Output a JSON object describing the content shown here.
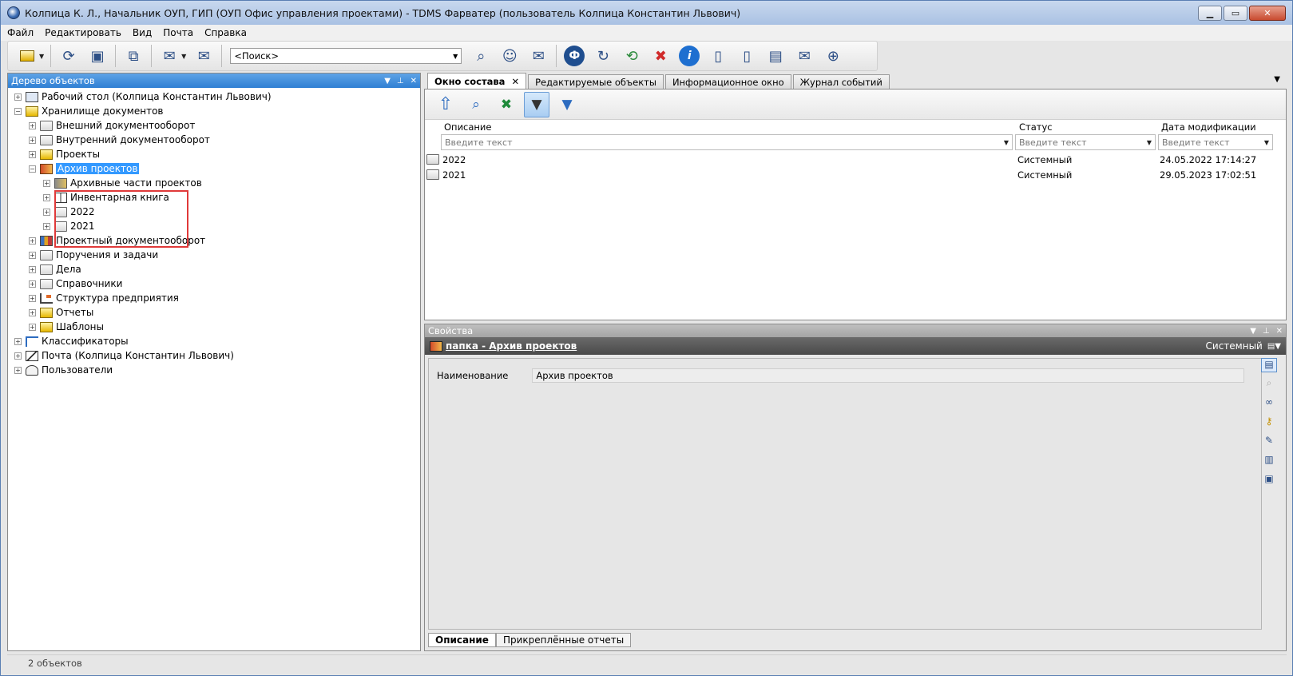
{
  "window": {
    "title": "Колпица К. Л., Начальник ОУП, ГИП (ОУП Офис управления проектами) - TDMS Фарватер (пользователь Колпица Константин Львович)"
  },
  "menu": [
    "Файл",
    "Редактировать",
    "Вид",
    "Почта",
    "Справка"
  ],
  "toolbar": {
    "search_placeholder": "<Поиск>"
  },
  "tree_panel": {
    "title": "Дерево объектов",
    "nodes": [
      {
        "label": "Рабочий стол (Колпица Константин Львович)",
        "level": 0,
        "icon": "desktop-icon"
      },
      {
        "label": "Хранилище документов",
        "level": 0,
        "icon": "storage-icon",
        "expanded": true
      },
      {
        "label": "Внешний документооборот",
        "level": 1,
        "icon": "folder-icon"
      },
      {
        "label": "Внутренний документооборот",
        "level": 1,
        "icon": "folder-icon"
      },
      {
        "label": "Проекты",
        "level": 1,
        "icon": "projects-icon"
      },
      {
        "label": "Архив проектов",
        "level": 1,
        "icon": "archive-icon",
        "expanded": true,
        "selected": true
      },
      {
        "label": "Архивные части проектов",
        "level": 2,
        "icon": "archive-parts-icon"
      },
      {
        "label": "Инвентарная книга",
        "level": 2,
        "icon": "book-icon"
      },
      {
        "label": "2022",
        "level": 2,
        "icon": "folder-icon"
      },
      {
        "label": "2021",
        "level": 2,
        "icon": "folder-icon"
      },
      {
        "label": "Проектный документооборот",
        "level": 1,
        "icon": "books-icon"
      },
      {
        "label": "Поручения и задачи",
        "level": 1,
        "icon": "folder-icon"
      },
      {
        "label": "Дела",
        "level": 1,
        "icon": "folder-icon"
      },
      {
        "label": "Справочники",
        "level": 1,
        "icon": "folder-icon"
      },
      {
        "label": "Структура предприятия",
        "level": 1,
        "icon": "org-structure-icon"
      },
      {
        "label": "Отчеты",
        "level": 1,
        "icon": "reports-icon"
      },
      {
        "label": "Шаблоны",
        "level": 1,
        "icon": "templates-icon"
      },
      {
        "label": "Классификаторы",
        "level": 0,
        "icon": "classifier-icon"
      },
      {
        "label": "Почта (Колпица Константин Львович)",
        "level": 0,
        "icon": "mail-icon"
      },
      {
        "label": "Пользователи",
        "level": 0,
        "icon": "users-icon"
      }
    ]
  },
  "tabs": [
    {
      "label": "Окно состава",
      "active": true
    },
    {
      "label": "Редактируемые объекты",
      "active": false
    },
    {
      "label": "Информационное окно",
      "active": false
    },
    {
      "label": "Журнал событий",
      "active": false
    }
  ],
  "composition": {
    "columns": [
      "Описание",
      "Статус",
      "Дата модификации"
    ],
    "filter_placeholder": "Введите текст",
    "rows": [
      {
        "name": "2022",
        "status": "Системный",
        "date": "24.05.2022 17:14:27"
      },
      {
        "name": "2021",
        "status": "Системный",
        "date": "29.05.2023 17:02:51"
      }
    ]
  },
  "properties": {
    "title": "Свойства",
    "object_label": "папка - Архив проектов",
    "object_status": "Системный",
    "field_label": "Наименование",
    "field_value": "Архив проектов",
    "tabs": [
      "Описание",
      "Прикреплённые отчеты"
    ]
  },
  "status": {
    "text": "2 объектов"
  }
}
